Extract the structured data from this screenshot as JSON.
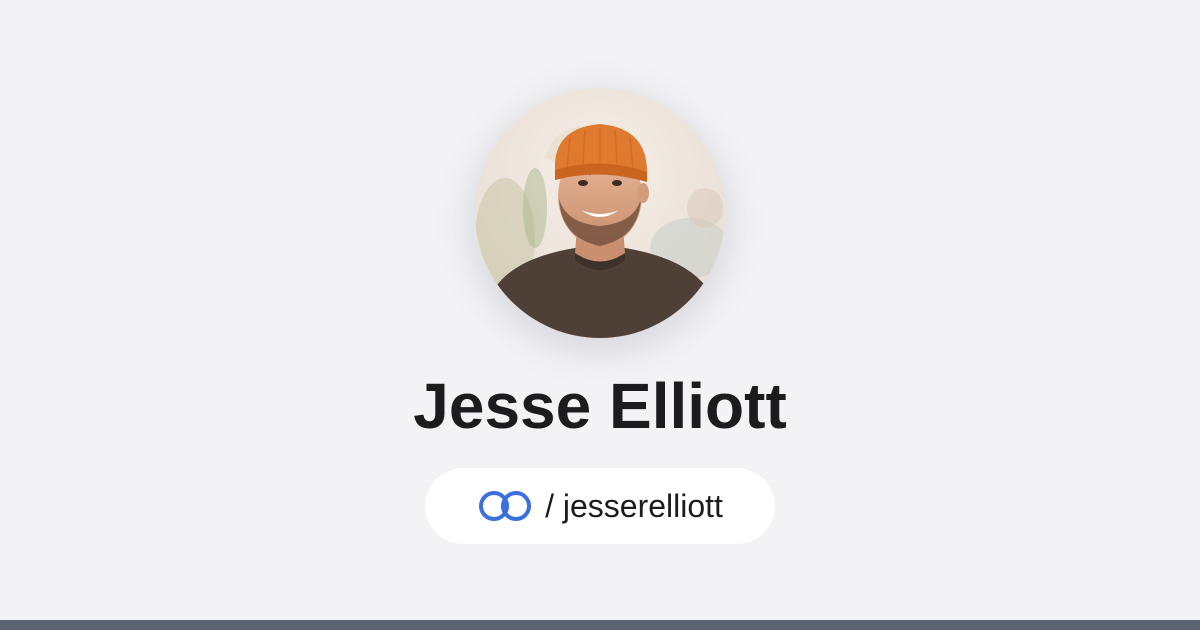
{
  "profile": {
    "name": "Jesse Elliott",
    "handle": "/ jesserelliott",
    "avatar_icon": "profile-photo"
  },
  "brand": {
    "logo_icon": "linked-rings-icon",
    "accent_color": "#3b6fe0"
  },
  "colors": {
    "background": "#f3f3f6",
    "footer_bar": "#5b6470",
    "text": "#1c1c1e"
  }
}
